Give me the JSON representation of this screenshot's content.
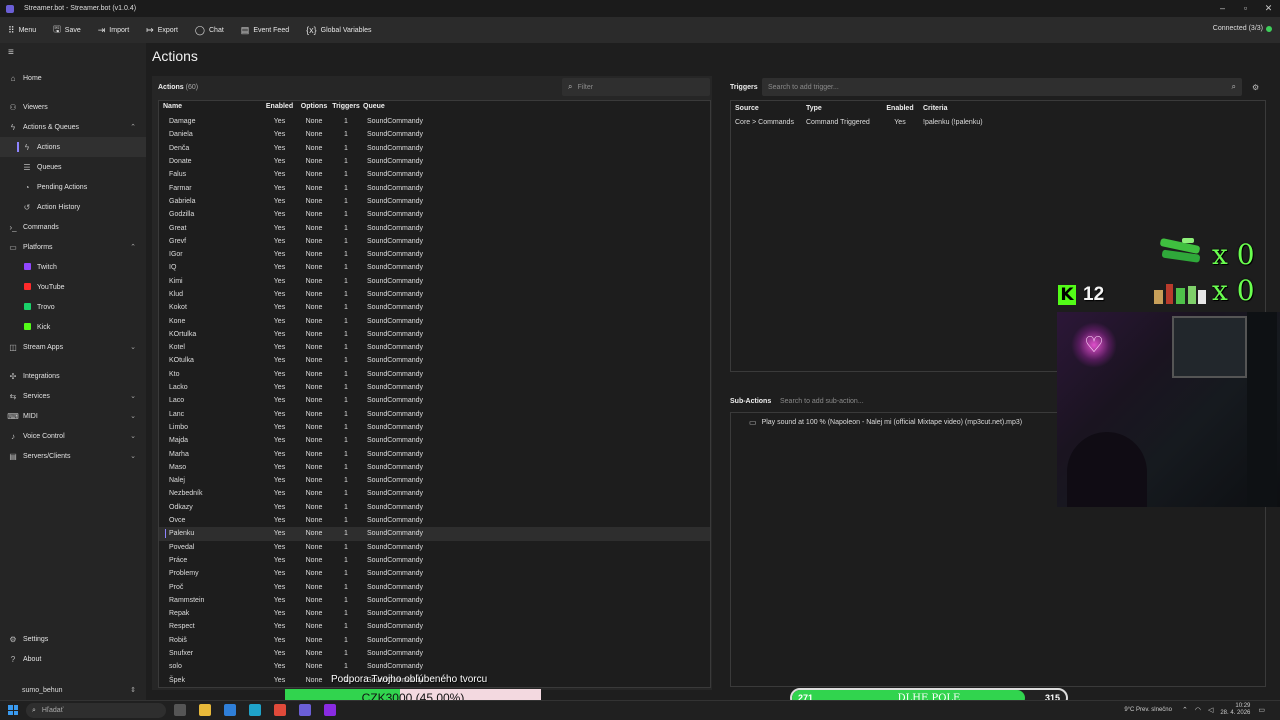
{
  "window": {
    "title": "Streamer.bot - Streamer.bot (v1.0.4)"
  },
  "menubar": {
    "items": [
      {
        "label": "Menu",
        "icon": "grid-icon"
      },
      {
        "label": "Save",
        "icon": "save-icon"
      },
      {
        "label": "Import",
        "icon": "import-icon"
      },
      {
        "label": "Export",
        "icon": "export-icon"
      },
      {
        "label": "Chat",
        "icon": "chat-icon"
      },
      {
        "label": "Event Feed",
        "icon": "feed-icon"
      },
      {
        "label": "Global Variables",
        "icon": "variables-icon"
      }
    ],
    "connected": "Connected (3/3)"
  },
  "sidebar": {
    "home": "Home",
    "viewers": "Viewers",
    "actions_queues": "Actions & Queues",
    "actions": "Actions",
    "queues": "Queues",
    "pending_actions": "Pending Actions",
    "action_history": "Action History",
    "commands": "Commands",
    "platforms": "Platforms",
    "twitch": "Twitch",
    "youtube": "YouTube",
    "trovo": "Trovo",
    "kick": "Kick",
    "stream_apps": "Stream Apps",
    "integrations": "Integrations",
    "services": "Services",
    "midi": "MIDI",
    "voice_control": "Voice Control",
    "servers_clients": "Servers/Clients",
    "settings": "Settings",
    "about": "About",
    "user": "sumo_behun"
  },
  "page": {
    "title": "Actions"
  },
  "actions": {
    "header": "Actions",
    "count": "(60)",
    "filter_placeholder": "Filter",
    "columns": {
      "name": "Name",
      "enabled": "Enabled",
      "options": "Options",
      "triggers": "Triggers",
      "queue": "Queue"
    },
    "rows": [
      "Damage",
      "Daniela",
      "Denča",
      "Donate",
      "Falus",
      "Farmar",
      "Gabriela",
      "Godzilla",
      "Great",
      "Grevf",
      "IGor",
      "IQ",
      "Kimi",
      "Klud",
      "Kokot",
      "Kone",
      "KOrtulka",
      "Kotel",
      "KOtulka",
      "Kto",
      "Lacko",
      "Laco",
      "Lanc",
      "Limbo",
      "Majda",
      "Marha",
      "Maso",
      "Nalej",
      "Nezbedník",
      "Odkazy",
      "Ovce",
      "Palenku",
      "Povedal",
      "Práce",
      "Problemy",
      "Proč",
      "Rammstein",
      "Repak",
      "Respect",
      "Robiš",
      "Snufxer",
      "solo",
      "Špek"
    ],
    "row_enabled": "Yes",
    "row_options": "None",
    "row_triggers": "1",
    "row_queue": "SoundCommandy",
    "selected": "Palenku"
  },
  "triggers": {
    "label": "Triggers",
    "search_placeholder": "Search to add trigger...",
    "columns": {
      "source": "Source",
      "type": "Type",
      "enabled": "Enabled",
      "criteria": "Criteria"
    },
    "row": {
      "source": "Core > Commands",
      "type": "Command Triggered",
      "enabled": "Yes",
      "criteria": "!palenku (!palenku)"
    }
  },
  "subactions": {
    "label": "Sub-Actions",
    "search_placeholder": "Search to add sub-action...",
    "item": "Play sound at 100 % (Napoleon - Nalej mi (official Mixtape video) (mp3cut.net).mp3)"
  },
  "overlay": {
    "count_top": "x 0",
    "count_bottom": "x 0",
    "kick_count": "12",
    "support_label": "Podpora Tvojho obľúbeného tvorcu",
    "goal_text": "CZK3000 (45.00%)",
    "goal_fraction": 0.45,
    "meter_low": "271",
    "meter_title": "DLHE POLE",
    "meter_high": "315",
    "meter_fraction": 0.85,
    "accent": "#31d44e"
  },
  "taskbar": {
    "search_placeholder": "Hľadať",
    "weather": "9°C  Prev. slnečno",
    "time": "10:29",
    "date": "28. 4. 2026"
  }
}
